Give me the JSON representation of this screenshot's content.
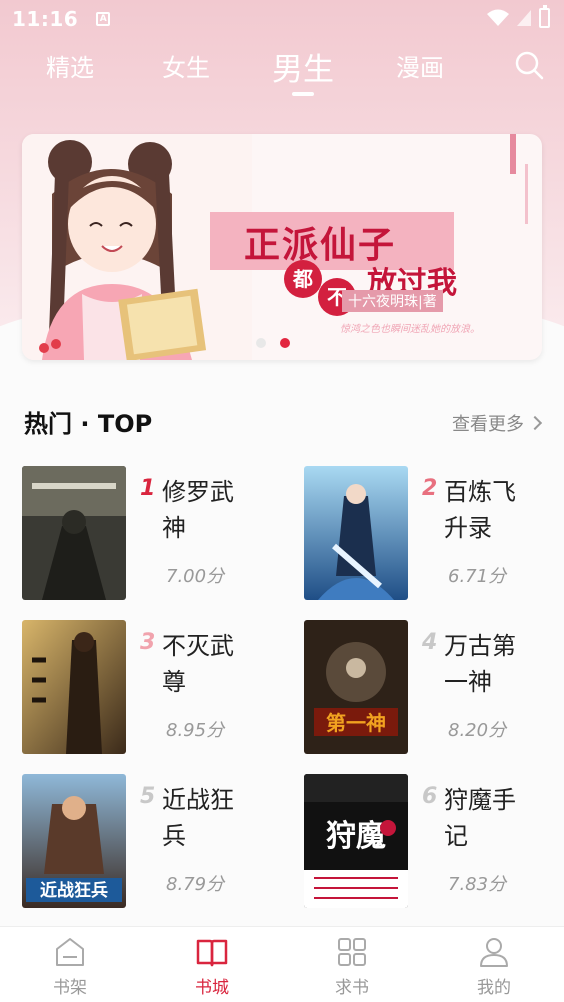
{
  "status_bar": {
    "time": "11:16",
    "notification_letter": "A"
  },
  "top_tabs": [
    {
      "label": "精选",
      "active": false
    },
    {
      "label": "女生",
      "active": false
    },
    {
      "label": "男生",
      "active": true
    },
    {
      "label": "漫画",
      "active": false
    }
  ],
  "banner": {
    "title": "正派仙子",
    "char1": "都",
    "char2": "不",
    "subtitle": "放过我",
    "author": "十六夜明珠|著",
    "tagline": "惊鸿之色也瞬间迷乱她的放浪。",
    "dots": 2,
    "active_dot": 1
  },
  "section": {
    "title": "热门 · TOP",
    "see_more": "查看更多"
  },
  "books": [
    {
      "rank": "1",
      "name": "修罗武神",
      "score": "7.00分",
      "rank_color": "#d9253e",
      "cover_color": "#3a3a34"
    },
    {
      "rank": "2",
      "name": "百炼飞升录",
      "score": "6.71分",
      "rank_color": "#e8707f",
      "cover_color": "#2b5f9a"
    },
    {
      "rank": "3",
      "name": "不灭武尊",
      "score": "8.95分",
      "rank_color": "#f1a3ad",
      "cover_color": "#7b5a36"
    },
    {
      "rank": "4",
      "name": "万古第一神",
      "score": "8.20分",
      "rank_color": "#c8c8c8",
      "cover_color": "#3b2a1c"
    },
    {
      "rank": "5",
      "name": "近战狂兵",
      "score": "8.79分",
      "rank_color": "#c8c8c8",
      "cover_color": "#5a3b2a"
    },
    {
      "rank": "6",
      "name": "狩魔手记",
      "score": "7.83分",
      "rank_color": "#c8c8c8",
      "cover_color": "#1a1a1a"
    }
  ],
  "cover_texts": {
    "b4": "第一神",
    "b5": "近战狂兵",
    "b6": "狩魔"
  },
  "bottom_nav": [
    {
      "label": "书架",
      "icon": "bookshelf-icon",
      "active": false
    },
    {
      "label": "书城",
      "icon": "book-open-icon",
      "active": true
    },
    {
      "label": "求书",
      "icon": "grid-icon",
      "active": false
    },
    {
      "label": "我的",
      "icon": "user-icon",
      "active": false
    }
  ],
  "colors": {
    "accent": "#d9253e",
    "header_pink": "#f2c9d0"
  }
}
